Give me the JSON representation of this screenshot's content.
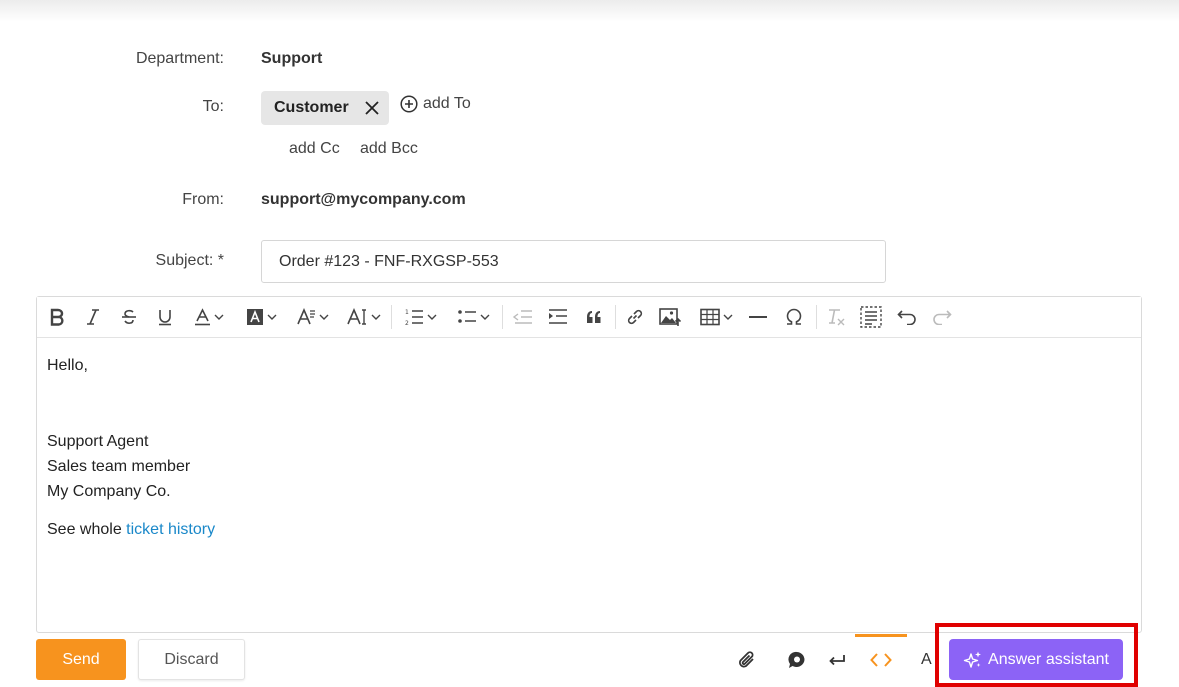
{
  "form": {
    "department_label": "Department:",
    "department_value": "Support",
    "to_label": "To:",
    "to_chip": "Customer",
    "add_to": "add To",
    "add_cc": "add Cc",
    "add_bcc": "add Bcc",
    "from_label": "From:",
    "from_value": "support@mycompany.com",
    "subject_label": "Subject: *",
    "subject_value": "Order #123 - FNF-RXGSP-553"
  },
  "toolbar": {
    "icons": [
      "bold-icon",
      "italic-icon",
      "strikethrough-icon",
      "underline-icon",
      "font-color-icon",
      "highlight-color-icon",
      "font-family-icon",
      "font-size-icon",
      "numbered-list-icon",
      "bulleted-list-icon",
      "outdent-icon",
      "indent-icon",
      "blockquote-icon",
      "link-icon",
      "insert-image-icon",
      "insert-table-icon",
      "horizontal-line-icon",
      "special-characters-icon",
      "remove-format-icon",
      "show-blocks-icon",
      "undo-icon",
      "redo-icon"
    ]
  },
  "editor": {
    "greeting": "Hello,",
    "signature": [
      "Support Agent",
      "Sales team member",
      "My Company Co."
    ],
    "history_prefix": "See whole ",
    "history_link": "ticket history"
  },
  "footer": {
    "send_label": "Send",
    "discard_label": "Discard",
    "ai_label": "A",
    "answer_assistant_label": "Answer assistant"
  },
  "colors": {
    "send": "#f7931e",
    "answer_assistant": "#8c63f6",
    "link": "#1a88c9",
    "highlight_box": "#e00000"
  }
}
